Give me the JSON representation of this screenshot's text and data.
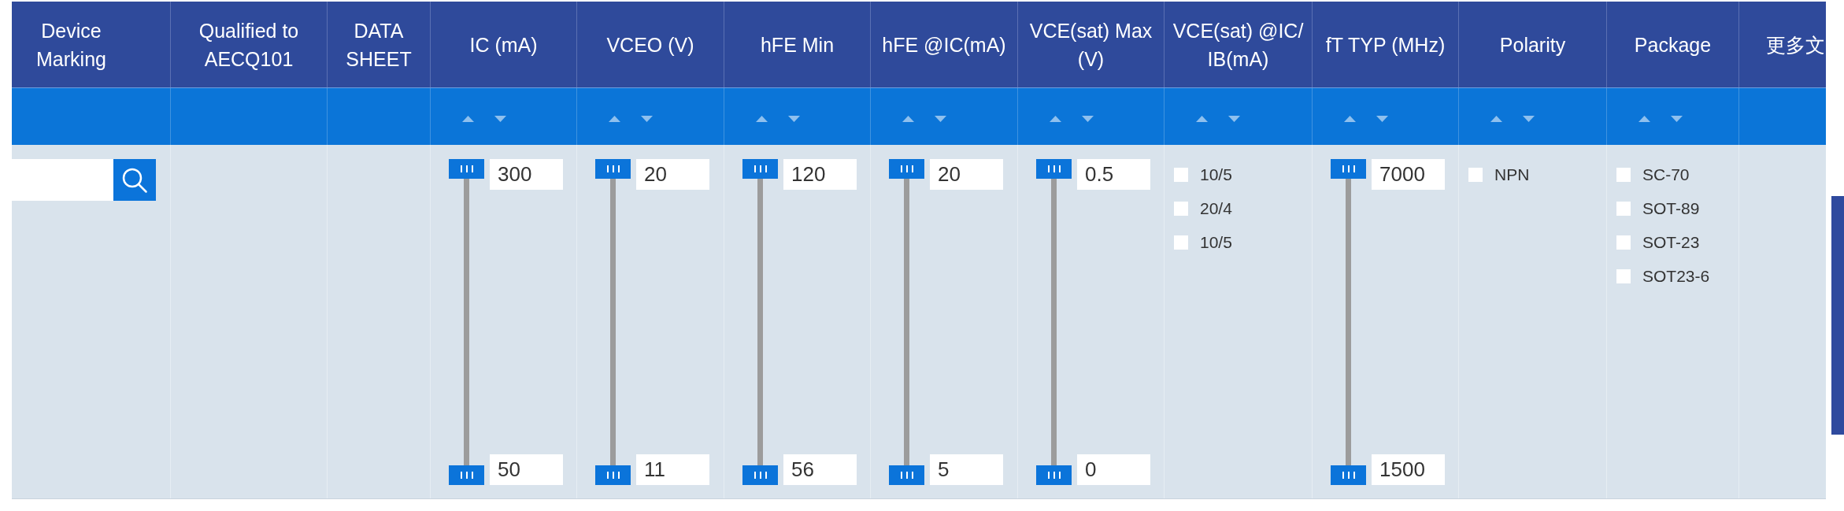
{
  "table": {
    "columns": [
      {
        "header": "Device\nMarking",
        "sortable": false,
        "filter": {
          "kind": "search"
        }
      },
      {
        "header": "Qualified to\nAECQ101",
        "sortable": false
      },
      {
        "header": "DATA\nSHEET",
        "sortable": false
      },
      {
        "header": "IC (mA)",
        "sortable": true,
        "filter": {
          "kind": "range",
          "thumbs": [
            {
              "value": "300",
              "level": 1
            },
            {
              "value": "50",
              "level": 0
            }
          ]
        }
      },
      {
        "header": "VCEO (V)",
        "sortable": true,
        "filter": {
          "kind": "range",
          "thumbs": [
            {
              "value": "20",
              "level": 1
            },
            {
              "value": "11",
              "level": 0
            }
          ]
        }
      },
      {
        "header": "hFE Min",
        "sortable": true,
        "filter": {
          "kind": "range",
          "thumbs": [
            {
              "value": "120",
              "level": 1
            },
            {
              "value": "56",
              "level": 0
            }
          ]
        }
      },
      {
        "header": "hFE @IC(mA)",
        "sortable": true,
        "filter": {
          "kind": "range",
          "thumbs": [
            {
              "value": "20",
              "level": 1
            },
            {
              "value": "5",
              "level": 0
            }
          ]
        }
      },
      {
        "header": "VCE(sat) Max\n(V)",
        "sortable": true,
        "filter": {
          "kind": "range",
          "thumbs": [
            {
              "value": "0.5",
              "level": 1
            },
            {
              "value": "0",
              "level": 0
            }
          ]
        }
      },
      {
        "header": "VCE(sat) @IC/\nIB(mA)",
        "sortable": true,
        "filter": {
          "kind": "checklist",
          "options": [
            {
              "label": "10/5",
              "checked": false
            },
            {
              "label": "20/4",
              "checked": false
            },
            {
              "label": "10/5",
              "checked": false
            }
          ]
        }
      },
      {
        "header": "fT TYP (MHz)",
        "sortable": true,
        "filter": {
          "kind": "range",
          "thumbs": [
            {
              "value": "7000",
              "level": 1
            },
            {
              "value": "1500",
              "level": 0
            }
          ]
        }
      },
      {
        "header": "Polarity",
        "sortable": true,
        "filter": {
          "kind": "checklist",
          "options": [
            {
              "label": "NPN",
              "checked": false
            }
          ]
        }
      },
      {
        "header": "Package",
        "sortable": true,
        "filter": {
          "kind": "checklist",
          "options": [
            {
              "label": "SC-70",
              "checked": false
            },
            {
              "label": "SOT-89",
              "checked": false
            },
            {
              "label": "SOT-23",
              "checked": false
            },
            {
              "label": "SOT23-6",
              "checked": false
            }
          ]
        }
      },
      {
        "header": "更多文",
        "sortable": false
      }
    ]
  }
}
